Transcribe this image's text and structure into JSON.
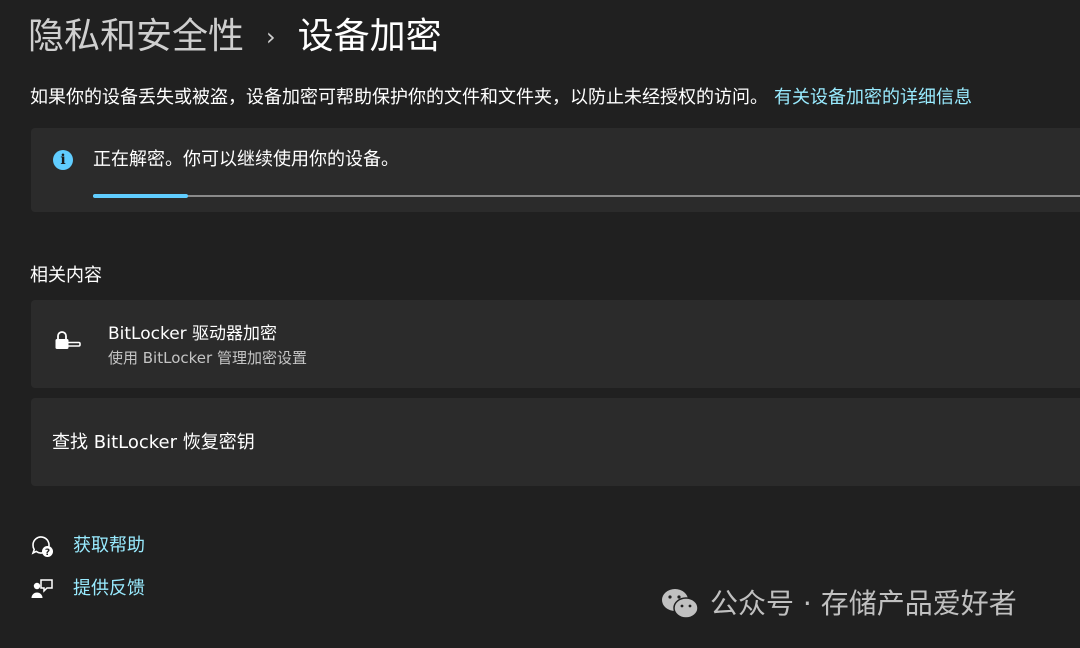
{
  "header": {
    "parent": "隐私和安全性",
    "separator": "›",
    "current": "设备加密"
  },
  "description": {
    "text": "如果你的设备丢失或被盗，设备加密可帮助保护你的文件和文件夹，以防止未经授权的访问。",
    "link": "有关设备加密的详细信息"
  },
  "status": {
    "icon": "info-icon",
    "text": "正在解密。你可以继续使用你的设备。",
    "progress_fraction": 0.095,
    "accent_color": "#60cdff"
  },
  "related": {
    "title": "相关内容",
    "items": [
      {
        "icon": "lock-key-icon",
        "title": "BitLocker 驱动器加密",
        "subtitle": "使用 BitLocker 管理加密设置"
      },
      {
        "title": "查找 BitLocker 恢复密钥"
      }
    ]
  },
  "help": {
    "get_help": "获取帮助",
    "feedback": "提供反馈"
  },
  "watermark": {
    "text": "公众号 · 存储产品爱好者"
  },
  "colors": {
    "background": "#202020",
    "card": "#2b2b2b",
    "link": "#99ebff"
  }
}
